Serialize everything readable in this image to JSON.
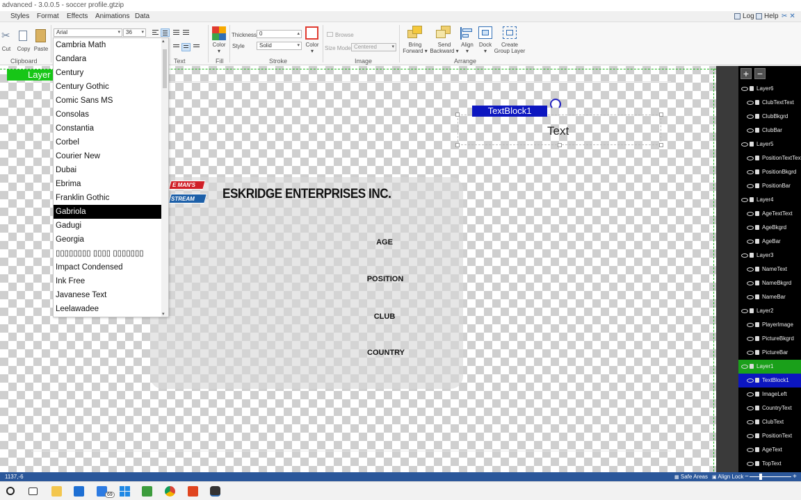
{
  "window": {
    "title": "advanced - 3.0.0.5 - soccer profile.gtzip"
  },
  "menu": {
    "items": [
      "Styles",
      "Format",
      "Effects",
      "Animations",
      "Data"
    ],
    "log_label": "Log",
    "help_label": "Help"
  },
  "ribbon": {
    "clipboard": {
      "cut": "Cut",
      "copy": "Copy",
      "paste": "Paste",
      "group": "Clipboard"
    },
    "text": {
      "font_value": "Arial",
      "size_value": "36",
      "group": "Text"
    },
    "fill": {
      "color_label": "Color",
      "group": "Fill",
      "swatch": "#e03a2f"
    },
    "stroke": {
      "thickness_label": "Thickness",
      "thickness_value": "0",
      "style_label": "Style",
      "style_value": "Solid",
      "color_label": "Color",
      "group": "Stroke"
    },
    "image": {
      "browse": "Browse",
      "size_mode_label": "Size Mode",
      "size_mode_value": "Centered",
      "group": "Image"
    },
    "arrange": {
      "bring_forward": [
        "Bring",
        "Forward"
      ],
      "send_backward": [
        "Send",
        "Backward"
      ],
      "align": "Align",
      "dock": "Dock",
      "create_group": [
        "Create",
        "Group Layer"
      ],
      "group": "Arrange"
    }
  },
  "font_list": {
    "items": [
      "Cambria Math",
      "Candara",
      "Century",
      "Century Gothic",
      "Comic Sans MS",
      "Consolas",
      "Constantia",
      "Corbel",
      "Courier New",
      "Dubai",
      "Ebrima",
      "Franklin Gothic",
      "Gabriola",
      "Gadugi",
      "Georgia",
      "▯▯▯▯▯▯▯▯ ▯▯▯▯ ▯▯▯▯▯▯▯",
      "Impact Condensed",
      "Ink Free",
      "Javanese Text",
      "Leelawadee"
    ],
    "selected_index": 12
  },
  "canvas": {
    "layer_tag": "Layer",
    "logo_top": "E MAN'S",
    "logo_bottom": "STREAM",
    "company": "ESKRIDGE ENTERPRISES INC.",
    "fields": [
      "AGE",
      "POSITION",
      "CLUB",
      "COUNTRY"
    ],
    "textblock_tag": "TextBlock1",
    "textblock_text": "Text"
  },
  "layers": [
    {
      "name": "Layer6",
      "type": "group"
    },
    {
      "name": "ClubTextText",
      "type": "child"
    },
    {
      "name": "ClubBkgrd",
      "type": "child"
    },
    {
      "name": "ClubBar",
      "type": "child"
    },
    {
      "name": "Layer5",
      "type": "group"
    },
    {
      "name": "PositionTextText",
      "type": "child"
    },
    {
      "name": "PositionBkgrd",
      "type": "child"
    },
    {
      "name": "PositionBar",
      "type": "child"
    },
    {
      "name": "Layer4",
      "type": "group"
    },
    {
      "name": "AgeTextText",
      "type": "child"
    },
    {
      "name": "AgeBkgrd",
      "type": "child"
    },
    {
      "name": "AgeBar",
      "type": "child"
    },
    {
      "name": "Layer3",
      "type": "group"
    },
    {
      "name": "NameText",
      "type": "child"
    },
    {
      "name": "NameBkgrd",
      "type": "child"
    },
    {
      "name": "NameBar",
      "type": "child"
    },
    {
      "name": "Layer2",
      "type": "group"
    },
    {
      "name": "PlayerImage",
      "type": "child"
    },
    {
      "name": "PictureBkgrd",
      "type": "child"
    },
    {
      "name": "PictureBar",
      "type": "child"
    },
    {
      "name": "Layer1",
      "type": "group",
      "state": "active"
    },
    {
      "name": "TextBlock1",
      "type": "child",
      "state": "active"
    },
    {
      "name": "ImageLeft",
      "type": "child"
    },
    {
      "name": "CountryText",
      "type": "child"
    },
    {
      "name": "ClubText",
      "type": "child"
    },
    {
      "name": "PositionText",
      "type": "child"
    },
    {
      "name": "AgeText",
      "type": "child"
    },
    {
      "name": "TopText",
      "type": "child"
    }
  ],
  "status": {
    "coords": "1137,-6",
    "safe_areas": "Safe Areas",
    "align_lock": "Align Lock"
  },
  "taskbar": {
    "mail_badge": "69"
  }
}
